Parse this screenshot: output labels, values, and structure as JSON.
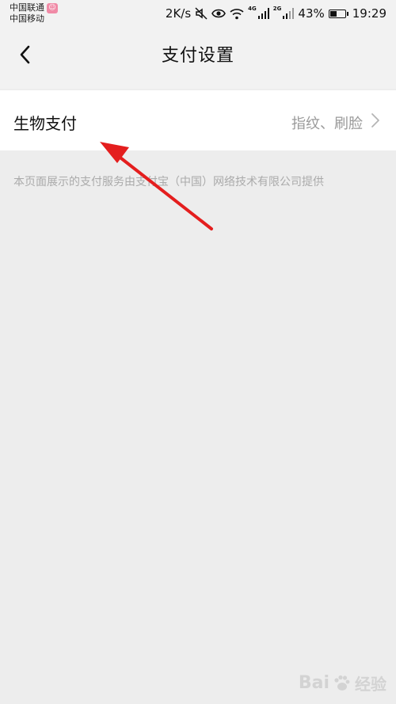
{
  "status_bar": {
    "carrier_1": "中国联通",
    "carrier_2": "中国移动",
    "app_badge": "☺",
    "speed": "2K/s",
    "network_tag_1": "4G",
    "network_tag_2": "2G",
    "battery": "43%",
    "battery_level": 0.43,
    "time": "19:29"
  },
  "nav": {
    "title": "支付设置"
  },
  "settings": {
    "biometric": {
      "label": "生物支付",
      "value": "指纹、刷脸"
    }
  },
  "footnote": "本页面展示的支付服务由支付宝（中国）网络技术有限公司提供",
  "watermark": {
    "brand_left": "Bai",
    "brand_right": "经验",
    "paw_icon": "paw-icon"
  },
  "colors": {
    "annotation_arrow": "#e41e1e",
    "background": "#ededed",
    "row_background": "#ffffff"
  }
}
